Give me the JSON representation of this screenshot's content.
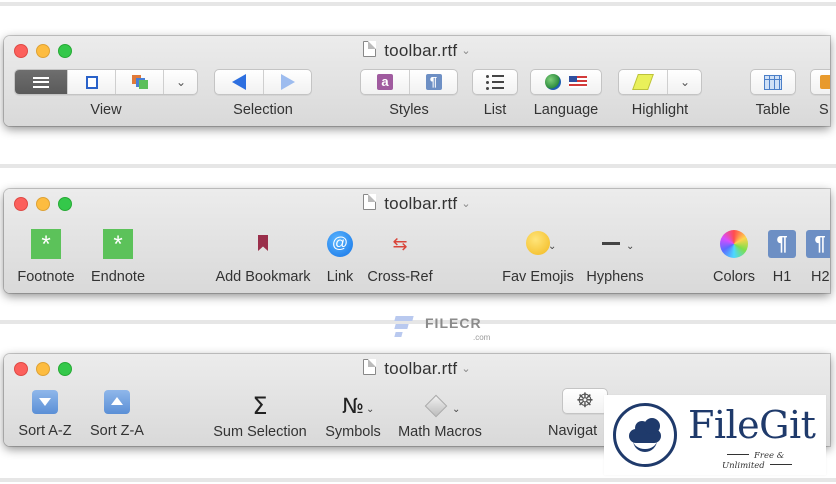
{
  "toolbar_windows": [
    {
      "title": "toolbar.rtf",
      "items": {
        "view": "View",
        "selection": "Selection",
        "styles": "Styles",
        "list": "List",
        "language": "Language",
        "highlight": "Highlight",
        "table": "Table",
        "truncated": "S"
      }
    },
    {
      "title": "toolbar.rtf",
      "items": {
        "footnote": "Footnote",
        "endnote": "Endnote",
        "add_bookmark": "Add Bookmark",
        "link": "Link",
        "cross_ref": "Cross-Ref",
        "fav_emojis": "Fav Emojis",
        "hyphens": "Hyphens",
        "colors": "Colors",
        "h1": "H1",
        "h2": "H2"
      }
    },
    {
      "title": "toolbar.rtf",
      "items": {
        "sort_a_z": "Sort A-Z",
        "sort_z_a": "Sort Z-A",
        "sum_selection": "Sum Selection",
        "symbols": "Symbols",
        "math_macros": "Math Macros",
        "navigation": "Navigat"
      }
    }
  ],
  "glyphs": {
    "styles_a": "a",
    "pilcrow": "¶",
    "sigma": "Σ",
    "numero": "№",
    "asterisk": "*",
    "at": "@",
    "cross_ref_arrows": "⇆",
    "ship_wheel": "☸",
    "chevron_down": "⌄"
  },
  "watermarks": {
    "filecr": {
      "name": "FILECR",
      "sub": ".com"
    },
    "filegit": {
      "name": "FileGit",
      "tagline": "Free & Unlimited"
    }
  },
  "colors": {
    "close": "#fc605c",
    "minimize": "#fdbc40",
    "zoom": "#34c84a",
    "accent_blue": "#2d6fe0",
    "filegit_navy": "#1f3a6b"
  }
}
